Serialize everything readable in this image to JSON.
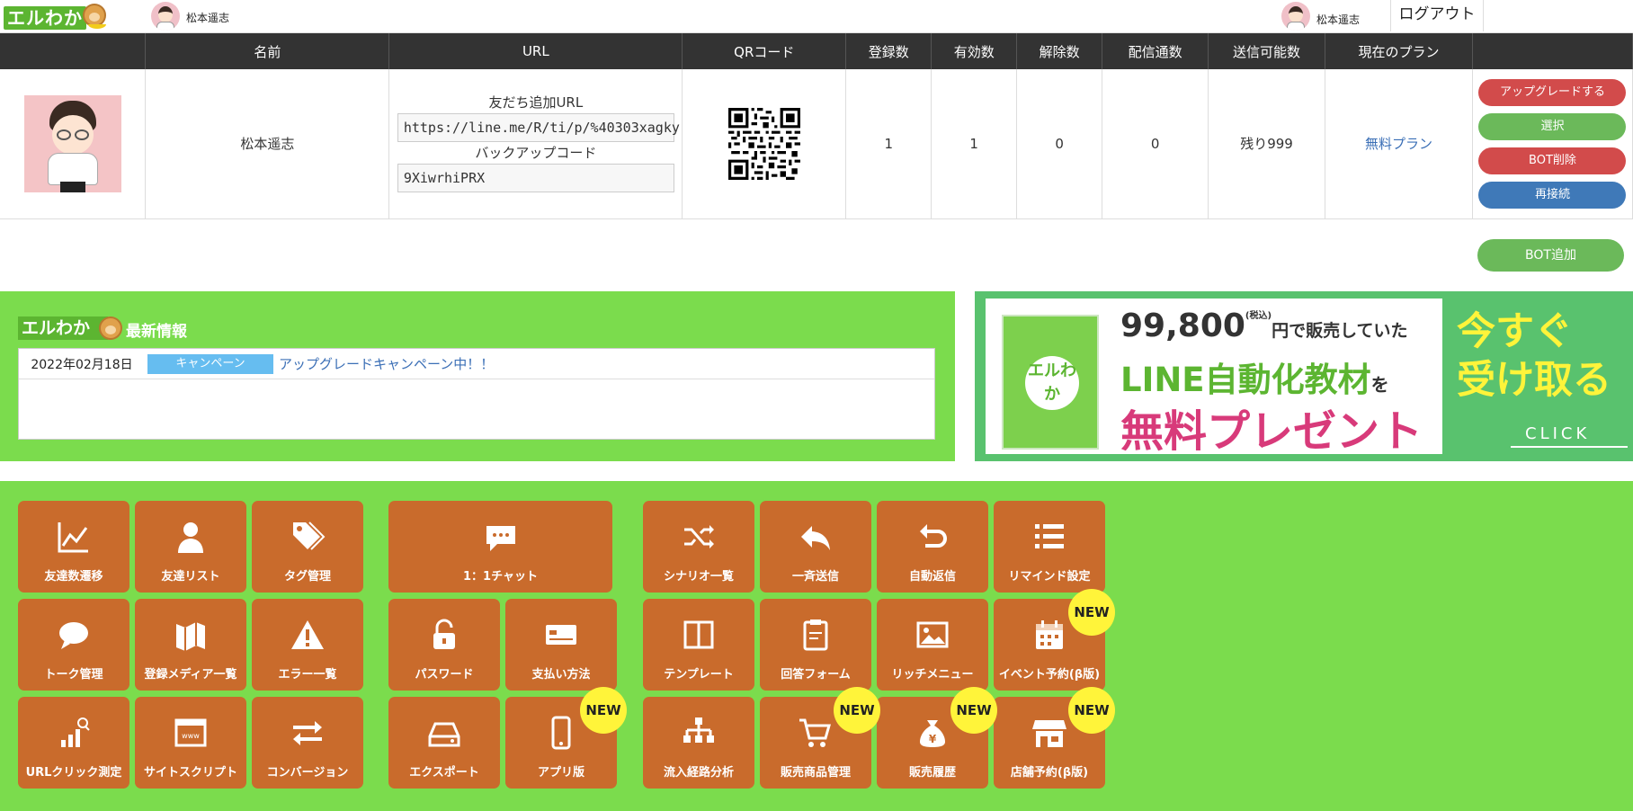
{
  "app": {
    "logo_text": "エルわか"
  },
  "topbar": {
    "left_user": "松本遥志",
    "right_user": "松本遥志",
    "logout": "ログアウト"
  },
  "table": {
    "headers": [
      "",
      "名前",
      "URL",
      "QRコード",
      "登録数",
      "有効数",
      "解除数",
      "配信通数",
      "送信可能数",
      "現在のプラン",
      ""
    ],
    "row": {
      "name": "松本遥志",
      "url_label": "友だち追加URL",
      "url_value": "https://line.me/R/ti/p/%40303xagky",
      "backup_label": "バックアップコード",
      "backup_value": "9XiwrhiPRX",
      "registered": "1",
      "valid": "1",
      "cancelled": "0",
      "delivered": "0",
      "remaining": "残り999",
      "plan": "無料プラン"
    },
    "actions": {
      "upgrade": "アップグレードする",
      "select": "選択",
      "delete": "BOT削除",
      "reconnect": "再接続"
    }
  },
  "add_bot": "BOT追加",
  "news": {
    "logo": "エルわか",
    "title": "最新情報",
    "items": [
      {
        "date": "2022年02月18日",
        "tag": "キャンペーン",
        "text": "アップグレードキャンペーン中！！"
      }
    ]
  },
  "promo": {
    "price": "99,800",
    "tax": "(税込)",
    "price_suffix": "円で販売していた",
    "product": "LINE自動化教材",
    "particle": "を",
    "headline": "無料プレゼント",
    "cta_1": "今すぐ",
    "cta_2": "受け取る",
    "click": "CLICK",
    "box_title": "エルわか"
  },
  "menu": {
    "tiles": [
      {
        "label": "友達数遷移",
        "icon": "line-chart-icon"
      },
      {
        "label": "友達リスト",
        "icon": "user-icon"
      },
      {
        "label": "タグ管理",
        "icon": "tags-icon"
      },
      {
        "label": "1：1チャット",
        "icon": "chat-bubble-icon"
      },
      {
        "label": "シナリオ一覧",
        "icon": "shuffle-icon"
      },
      {
        "label": "一斉送信",
        "icon": "reply-icon"
      },
      {
        "label": "自動返信",
        "icon": "undo-icon"
      },
      {
        "label": "リマインド設定",
        "icon": "list-icon"
      },
      {
        "label": "トーク管理",
        "icon": "comment-icon"
      },
      {
        "label": "登録メディア一覧",
        "icon": "map-icon"
      },
      {
        "label": "エラー一覧",
        "icon": "warning-icon"
      },
      {
        "label": "パスワード",
        "icon": "unlock-icon"
      },
      {
        "label": "支払い方法",
        "icon": "credit-card-icon"
      },
      {
        "label": "テンプレート",
        "icon": "columns-icon"
      },
      {
        "label": "回答フォーム",
        "icon": "clipboard-icon"
      },
      {
        "label": "リッチメニュー",
        "icon": "image-icon"
      },
      {
        "label": "イベント予約(β版)",
        "icon": "calendar-icon"
      },
      {
        "label": "URLクリック測定",
        "icon": "bar-search-icon"
      },
      {
        "label": "サイトスクリプト",
        "icon": "browser-icon"
      },
      {
        "label": "コンバージョン",
        "icon": "exchange-icon"
      },
      {
        "label": "エクスポート",
        "icon": "hdd-icon"
      },
      {
        "label": "アプリ版",
        "icon": "mobile-icon"
      },
      {
        "label": "流入経路分析",
        "icon": "sitemap-icon"
      },
      {
        "label": "販売商品管理",
        "icon": "cart-icon"
      },
      {
        "label": "販売履歴",
        "icon": "money-bag-icon"
      },
      {
        "label": "店舗予約(β版)",
        "icon": "store-icon"
      }
    ],
    "new_badge": "NEW"
  }
}
